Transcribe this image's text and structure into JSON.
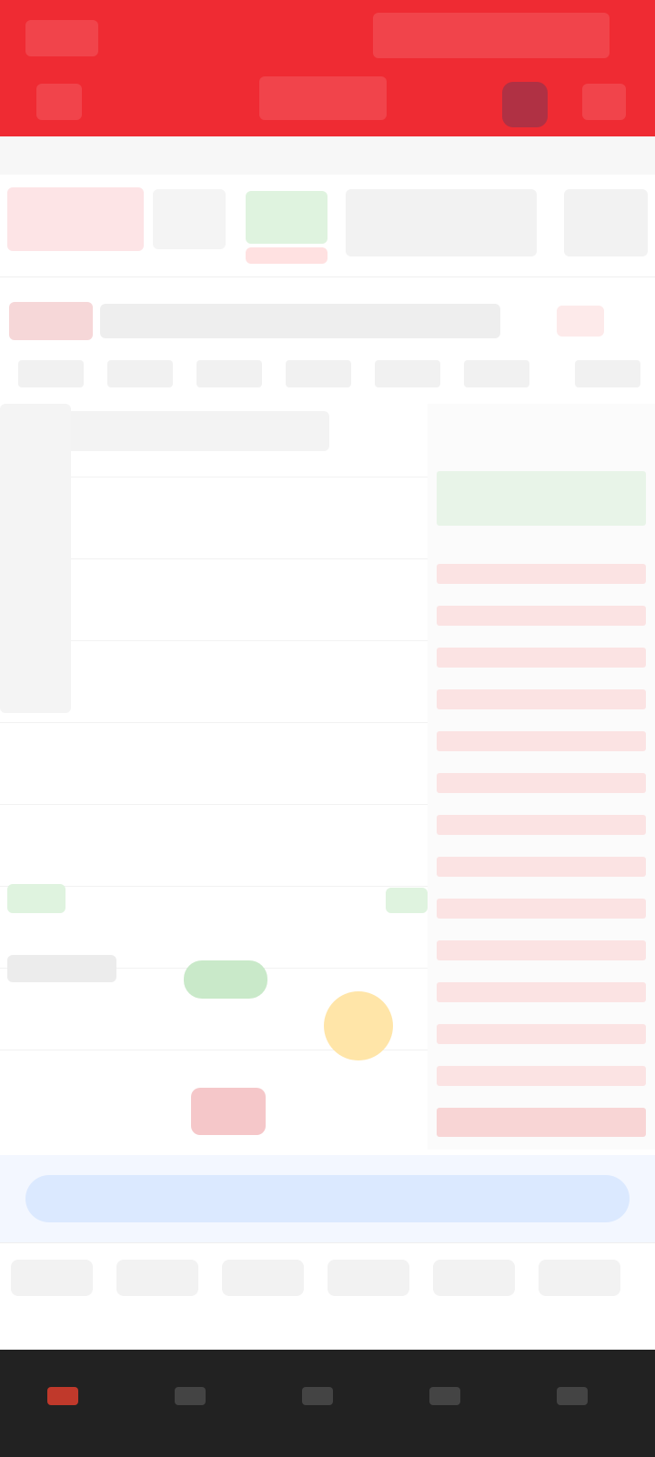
{
  "header": {
    "title": "",
    "subtitle": ""
  },
  "banner": {
    "text": ""
  },
  "bottom_nav": {
    "items": [
      {
        "label": ""
      },
      {
        "label": ""
      },
      {
        "label": ""
      },
      {
        "label": ""
      },
      {
        "label": ""
      }
    ]
  },
  "colors": {
    "brand_red": "#ef2b33",
    "positive_green": "#2ea043",
    "negative_red": "#e74c3c"
  }
}
